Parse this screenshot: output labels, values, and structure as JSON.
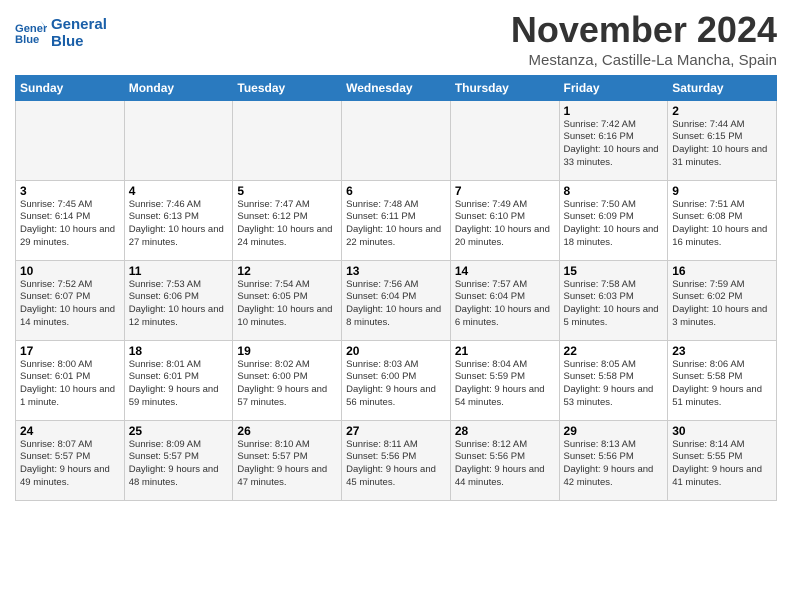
{
  "header": {
    "logo_line1": "General",
    "logo_line2": "Blue",
    "month_title": "November 2024",
    "location": "Mestanza, Castille-La Mancha, Spain"
  },
  "weekdays": [
    "Sunday",
    "Monday",
    "Tuesday",
    "Wednesday",
    "Thursday",
    "Friday",
    "Saturday"
  ],
  "weeks": [
    [
      {
        "day": "",
        "info": ""
      },
      {
        "day": "",
        "info": ""
      },
      {
        "day": "",
        "info": ""
      },
      {
        "day": "",
        "info": ""
      },
      {
        "day": "",
        "info": ""
      },
      {
        "day": "1",
        "info": "Sunrise: 7:42 AM\nSunset: 6:16 PM\nDaylight: 10 hours and 33 minutes."
      },
      {
        "day": "2",
        "info": "Sunrise: 7:44 AM\nSunset: 6:15 PM\nDaylight: 10 hours and 31 minutes."
      }
    ],
    [
      {
        "day": "3",
        "info": "Sunrise: 7:45 AM\nSunset: 6:14 PM\nDaylight: 10 hours and 29 minutes."
      },
      {
        "day": "4",
        "info": "Sunrise: 7:46 AM\nSunset: 6:13 PM\nDaylight: 10 hours and 27 minutes."
      },
      {
        "day": "5",
        "info": "Sunrise: 7:47 AM\nSunset: 6:12 PM\nDaylight: 10 hours and 24 minutes."
      },
      {
        "day": "6",
        "info": "Sunrise: 7:48 AM\nSunset: 6:11 PM\nDaylight: 10 hours and 22 minutes."
      },
      {
        "day": "7",
        "info": "Sunrise: 7:49 AM\nSunset: 6:10 PM\nDaylight: 10 hours and 20 minutes."
      },
      {
        "day": "8",
        "info": "Sunrise: 7:50 AM\nSunset: 6:09 PM\nDaylight: 10 hours and 18 minutes."
      },
      {
        "day": "9",
        "info": "Sunrise: 7:51 AM\nSunset: 6:08 PM\nDaylight: 10 hours and 16 minutes."
      }
    ],
    [
      {
        "day": "10",
        "info": "Sunrise: 7:52 AM\nSunset: 6:07 PM\nDaylight: 10 hours and 14 minutes."
      },
      {
        "day": "11",
        "info": "Sunrise: 7:53 AM\nSunset: 6:06 PM\nDaylight: 10 hours and 12 minutes."
      },
      {
        "day": "12",
        "info": "Sunrise: 7:54 AM\nSunset: 6:05 PM\nDaylight: 10 hours and 10 minutes."
      },
      {
        "day": "13",
        "info": "Sunrise: 7:56 AM\nSunset: 6:04 PM\nDaylight: 10 hours and 8 minutes."
      },
      {
        "day": "14",
        "info": "Sunrise: 7:57 AM\nSunset: 6:04 PM\nDaylight: 10 hours and 6 minutes."
      },
      {
        "day": "15",
        "info": "Sunrise: 7:58 AM\nSunset: 6:03 PM\nDaylight: 10 hours and 5 minutes."
      },
      {
        "day": "16",
        "info": "Sunrise: 7:59 AM\nSunset: 6:02 PM\nDaylight: 10 hours and 3 minutes."
      }
    ],
    [
      {
        "day": "17",
        "info": "Sunrise: 8:00 AM\nSunset: 6:01 PM\nDaylight: 10 hours and 1 minute."
      },
      {
        "day": "18",
        "info": "Sunrise: 8:01 AM\nSunset: 6:01 PM\nDaylight: 9 hours and 59 minutes."
      },
      {
        "day": "19",
        "info": "Sunrise: 8:02 AM\nSunset: 6:00 PM\nDaylight: 9 hours and 57 minutes."
      },
      {
        "day": "20",
        "info": "Sunrise: 8:03 AM\nSunset: 6:00 PM\nDaylight: 9 hours and 56 minutes."
      },
      {
        "day": "21",
        "info": "Sunrise: 8:04 AM\nSunset: 5:59 PM\nDaylight: 9 hours and 54 minutes."
      },
      {
        "day": "22",
        "info": "Sunrise: 8:05 AM\nSunset: 5:58 PM\nDaylight: 9 hours and 53 minutes."
      },
      {
        "day": "23",
        "info": "Sunrise: 8:06 AM\nSunset: 5:58 PM\nDaylight: 9 hours and 51 minutes."
      }
    ],
    [
      {
        "day": "24",
        "info": "Sunrise: 8:07 AM\nSunset: 5:57 PM\nDaylight: 9 hours and 49 minutes."
      },
      {
        "day": "25",
        "info": "Sunrise: 8:09 AM\nSunset: 5:57 PM\nDaylight: 9 hours and 48 minutes."
      },
      {
        "day": "26",
        "info": "Sunrise: 8:10 AM\nSunset: 5:57 PM\nDaylight: 9 hours and 47 minutes."
      },
      {
        "day": "27",
        "info": "Sunrise: 8:11 AM\nSunset: 5:56 PM\nDaylight: 9 hours and 45 minutes."
      },
      {
        "day": "28",
        "info": "Sunrise: 8:12 AM\nSunset: 5:56 PM\nDaylight: 9 hours and 44 minutes."
      },
      {
        "day": "29",
        "info": "Sunrise: 8:13 AM\nSunset: 5:56 PM\nDaylight: 9 hours and 42 minutes."
      },
      {
        "day": "30",
        "info": "Sunrise: 8:14 AM\nSunset: 5:55 PM\nDaylight: 9 hours and 41 minutes."
      }
    ]
  ]
}
